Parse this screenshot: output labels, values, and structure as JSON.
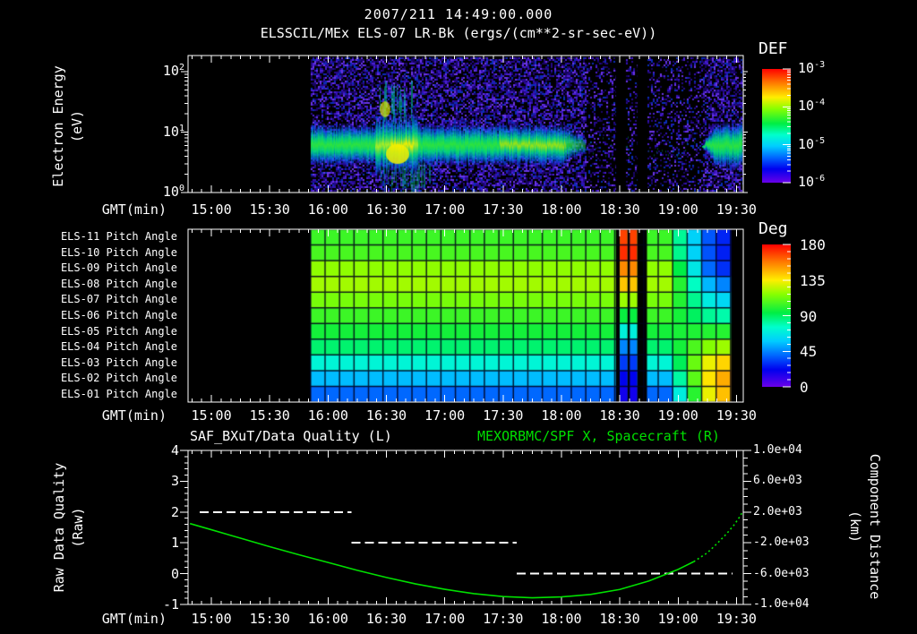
{
  "header": {
    "title_line1": "2007/211 14:49:00.000",
    "title_line2": "ELSSCIL/MEx ELS-07 LR-Bk  (ergs/(cm**2-sr-sec-eV))"
  },
  "axis": {
    "x_label": "GMT(min)",
    "x_ticks": [
      "15:00",
      "15:30",
      "16:00",
      "16:30",
      "17:00",
      "17:30",
      "18:00",
      "18:30",
      "19:00",
      "19:30"
    ],
    "x_minor_step_minutes": 5,
    "x_start": "14:48",
    "x_end": "19:33"
  },
  "panel1": {
    "ylabel1": "Electron Energy",
    "ylabel2": "(eV)",
    "ytick_base": "10",
    "ytick_exponents": [
      "2",
      "1",
      "0"
    ]
  },
  "colorbar1": {
    "title": "DEF",
    "tick_base": "10",
    "tick_exponents": [
      "-3",
      "-4",
      "-5",
      "-6"
    ]
  },
  "panel2": {
    "row_labels": [
      "ELS-11 Pitch Angle",
      "ELS-10 Pitch Angle",
      "ELS-09 Pitch Angle",
      "ELS-08 Pitch Angle",
      "ELS-07 Pitch Angle",
      "ELS-06 Pitch Angle",
      "ELS-05 Pitch Angle",
      "ELS-04 Pitch Angle",
      "ELS-03 Pitch Angle",
      "ELS-02 Pitch Angle",
      "ELS-01 Pitch Angle"
    ]
  },
  "colorbar2": {
    "title": "Deg",
    "ticks": [
      "180",
      "135",
      "90",
      "45",
      "0"
    ]
  },
  "panel3": {
    "title_left": "SAF_BXuT/Data Quality (L)",
    "title_right": "MEXORBMC/SPF X, Spacecraft (R)",
    "ylabel_left1": "Raw Data Quality",
    "ylabel_left2": "(Raw)",
    "left_ticks": [
      "4",
      "3",
      "2",
      "1",
      "0",
      "-1"
    ],
    "right_ticks": [
      "1.0e+04",
      "6.0e+03",
      "2.0e+03",
      "-2.0e+03",
      "-6.0e+03",
      "-1.0e+04"
    ],
    "ylabel_right1": "Component Distance",
    "ylabel_right2": "(km)"
  },
  "chart_data": [
    {
      "id": "electron_energy_spectrogram",
      "type": "heatmap",
      "title": "ELSSCIL/MEx ELS-07 LR-Bk",
      "units": "ergs/(cm**2-sr-sec-eV)",
      "xlabel": "GMT(min)",
      "ylabel": "Electron Energy (eV)",
      "y_scale": "log",
      "ylim_ev": [
        1,
        185
      ],
      "y_tick_values_ev": [
        1,
        10,
        100
      ],
      "x_range_gmt": [
        "14:48",
        "19:33"
      ],
      "data_start": "15:51",
      "colorbar": {
        "label": "DEF",
        "min": "1e-6",
        "max": "1e-3",
        "tick_values": [
          "1e-3",
          "1e-4",
          "1e-5",
          "1e-6"
        ],
        "palette": [
          "#6a00e8",
          "#0000ee",
          "#0066ff",
          "#00ccff",
          "#00ffcc",
          "#00ee44",
          "#88ff00",
          "#ffee00",
          "#ff7700",
          "#ff0000"
        ],
        "palette_pos": [
          0,
          0.12,
          0.22,
          0.32,
          0.42,
          0.52,
          0.65,
          0.75,
          0.88,
          1
        ]
      },
      "features": [
        {
          "kind": "background_noise",
          "gmt": [
            "15:51",
            "19:33"
          ],
          "desc": "speckled violet-blue noise near 1e-6"
        },
        {
          "kind": "band",
          "gmt": [
            "15:51",
            "18:12"
          ],
          "energy_ev": [
            4,
            22
          ],
          "def_level": "~1e-4",
          "desc": "bright green electron band near 10 eV"
        },
        {
          "kind": "burst",
          "gmt": [
            "16:24",
            "16:46"
          ],
          "energy_ev": [
            3,
            80
          ],
          "def_level": "~3e-4",
          "desc": "yellow enhancement with vertical streaks"
        },
        {
          "kind": "faded",
          "gmt": [
            "18:12",
            "19:12"
          ],
          "desc": "flux dropout, dim blue speckle only"
        },
        {
          "kind": "data_gap",
          "gmt": [
            "18:28",
            "18:33"
          ]
        },
        {
          "kind": "data_gap",
          "gmt": [
            "18:39",
            "18:44"
          ]
        },
        {
          "kind": "band",
          "gmt": [
            "19:12",
            "19:33"
          ],
          "energy_ev": [
            4,
            25
          ],
          "def_level": "~1e-4",
          "desc": "green blob returns at end"
        }
      ]
    },
    {
      "id": "pitch_angle_rows",
      "type": "heatmap",
      "rows": [
        "ELS-11 Pitch Angle",
        "ELS-10 Pitch Angle",
        "ELS-09 Pitch Angle",
        "ELS-08 Pitch Angle",
        "ELS-07 Pitch Angle",
        "ELS-06 Pitch Angle",
        "ELS-05 Pitch Angle",
        "ELS-04 Pitch Angle",
        "ELS-03 Pitch Angle",
        "ELS-02 Pitch Angle",
        "ELS-01 Pitch Angle"
      ],
      "colorbar": {
        "label": "Deg",
        "ticks": [
          180,
          135,
          90,
          45,
          0
        ]
      },
      "data_start": "15:51",
      "data_end": "19:27",
      "row_mean_deg": [
        104,
        106,
        118,
        121,
        114,
        104,
        97,
        88,
        72,
        55,
        40
      ],
      "end_region_deg": [
        28,
        27,
        30,
        45,
        62,
        80,
        100,
        120,
        140,
        148,
        144
      ],
      "inverted_deg": [
        168,
        172,
        155,
        143,
        120,
        95,
        70,
        45,
        32,
        22,
        18
      ],
      "features": [
        {
          "kind": "thin_gap",
          "gmt": [
            "18:28",
            "18:30"
          ]
        },
        {
          "kind": "inverted_column",
          "gmt": [
            "18:30",
            "18:34"
          ],
          "desc": "top rows ~170 deg (red), bottom rows ~20 deg (blue)"
        },
        {
          "kind": "thin_gap",
          "gmt": [
            "18:34",
            "18:35"
          ]
        },
        {
          "kind": "inverted_column",
          "gmt": [
            "18:35",
            "18:39"
          ]
        },
        {
          "kind": "data_gap",
          "gmt": [
            "18:39",
            "18:44"
          ]
        },
        {
          "kind": "end_region",
          "gmt": [
            "18:54",
            "19:27"
          ],
          "desc": "top rows turn blue (~30 deg), bottom rows turn orange (~145 deg)"
        }
      ]
    },
    {
      "id": "quality_and_distance",
      "type": "line",
      "title_left": "SAF_BXuT/Data Quality (L)",
      "title_right": "MEXORBMC/SPF X, Spacecraft (R)",
      "ylabel_left": "Raw Data Quality (Raw)",
      "ylabel_right": "Component Distance (km)",
      "ylim_left": [
        -1,
        4
      ],
      "ylim_right_km": [
        -10000,
        10000
      ],
      "series": [
        {
          "name": "SAF_BXuT/Data Quality",
          "axis": "left",
          "style": "dashed",
          "color": "#ffffff",
          "segments": [
            {
              "value": 2,
              "gmt": [
                "14:54",
                "16:12"
              ]
            },
            {
              "value": 1,
              "gmt": [
                "16:12",
                "17:37"
              ]
            },
            {
              "value": 0,
              "gmt": [
                "17:37",
                "19:28"
              ]
            }
          ]
        },
        {
          "name": "MEXORBMC/SPF X, Spacecraft",
          "axis": "right",
          "color": "#00e000",
          "dotted_after": "19:05",
          "points": [
            [
              "14:49",
              500
            ],
            [
              "15:00",
              -300
            ],
            [
              "15:15",
              -1400
            ],
            [
              "15:30",
              -2500
            ],
            [
              "15:45",
              -3550
            ],
            [
              "16:00",
              -4550
            ],
            [
              "16:15",
              -5570
            ],
            [
              "16:30",
              -6500
            ],
            [
              "16:45",
              -7330
            ],
            [
              "17:00",
              -8030
            ],
            [
              "17:15",
              -8600
            ],
            [
              "17:30",
              -8980
            ],
            [
              "17:45",
              -9130
            ],
            [
              "18:00",
              -9020
            ],
            [
              "18:15",
              -8700
            ],
            [
              "18:30",
              -8050
            ],
            [
              "18:45",
              -6950
            ],
            [
              "19:00",
              -5450
            ],
            [
              "19:08",
              -4450
            ],
            [
              "19:15",
              -3300
            ],
            [
              "19:20",
              -2100
            ],
            [
              "19:25",
              -800
            ],
            [
              "19:29",
              400
            ],
            [
              "19:32",
              1500
            ],
            [
              "19:33",
              2000
            ]
          ]
        }
      ]
    }
  ]
}
